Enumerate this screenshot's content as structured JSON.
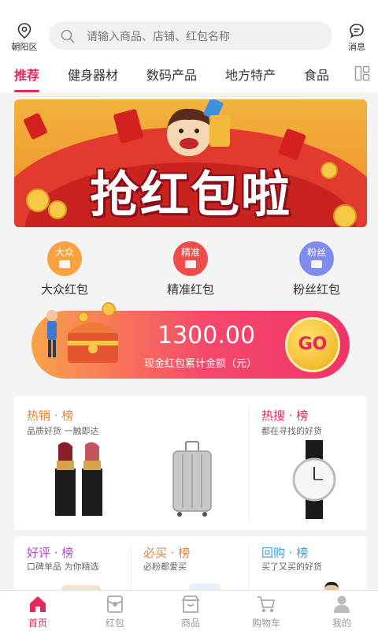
{
  "header": {
    "location": "朝阳区",
    "search_placeholder": "请输入商品、店铺、红包名称",
    "message_label": "消息"
  },
  "tabs": [
    {
      "label": "推荐",
      "active": true
    },
    {
      "label": "健身器材",
      "active": false
    },
    {
      "label": "数码产品",
      "active": false
    },
    {
      "label": "地方特产",
      "active": false
    },
    {
      "label": "食品",
      "active": false
    }
  ],
  "banner": {
    "title": "抢红包啦"
  },
  "categories": [
    {
      "badge": "大众",
      "label": "大众红包",
      "color": "#f8a340"
    },
    {
      "badge": "精准",
      "label": "精准红包",
      "color": "#f04d4a"
    },
    {
      "badge": "粉丝",
      "label": "粉丝红包",
      "color": "#7f8bf0"
    }
  ],
  "cash": {
    "amount": "1300.00",
    "subtitle": "现金红包累计金额（元）",
    "go_label": "GO"
  },
  "rankings": [
    {
      "title": "热销 · 榜",
      "subtitle": "品质好货 一触即达",
      "color": "#e8823a"
    },
    {
      "title": "热搜 · 榜",
      "subtitle": "都在寻找的好货",
      "color": "#e8265a"
    },
    {
      "title": "好评 · 榜",
      "subtitle": "口碑单品 为你精选",
      "color": "#b24bd0"
    },
    {
      "title": "必买 · 榜",
      "subtitle": "必粉都爱买",
      "color": "#e8823a"
    },
    {
      "title": "回购 · 榜",
      "subtitle": "买了又买的好货",
      "color": "#3aa0d8"
    }
  ],
  "nav": [
    {
      "label": "首页",
      "icon": "home-icon",
      "active": true
    },
    {
      "label": "红包",
      "icon": "red-envelope-icon",
      "active": false
    },
    {
      "label": "商品",
      "icon": "shop-icon",
      "active": false
    },
    {
      "label": "购物车",
      "icon": "cart-icon",
      "active": false
    },
    {
      "label": "我的",
      "icon": "user-icon",
      "active": false
    }
  ],
  "colors": {
    "accent": "#e8265a",
    "inactive": "#999999"
  }
}
